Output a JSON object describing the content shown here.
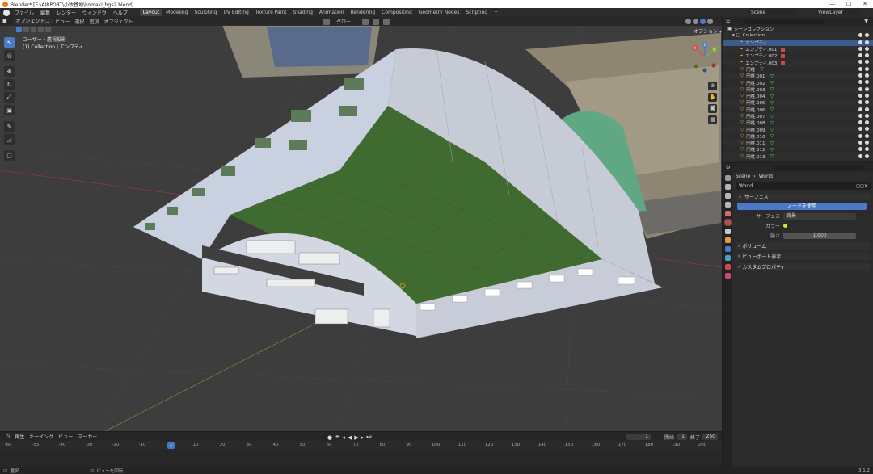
{
  "window": {
    "title": "Blender* [E:\\AIRPORT\\小牧基地\\komaki_hgs2.blend]",
    "buttons": [
      "—",
      "☐",
      "✕"
    ]
  },
  "topbar": {
    "menu": [
      "ファイル",
      "編集",
      "レンダー",
      "ウィンドウ",
      "ヘルプ"
    ],
    "tabs": [
      "Layout",
      "Modeling",
      "Sculpting",
      "UV Editing",
      "Texture Paint",
      "Shading",
      "Animation",
      "Rendering",
      "Compositing",
      "Geometry Nodes",
      "Scripting"
    ],
    "active_tab": "Layout",
    "add_tab": "+",
    "scene": "Scene",
    "view_layer": "ViewLayer"
  },
  "viewport": {
    "header": {
      "mode": "オブジェクト...",
      "menu": [
        "ビュー",
        "選択",
        "追加",
        "オブジェクト"
      ],
      "transform": "グロー..."
    },
    "options": "オプション ▾",
    "info_line1": "ユーザー・透視投影",
    "info_line2": "(1) Collection | エンプティ",
    "gizmo": {
      "x": "X",
      "y": "Y",
      "z": "Z"
    }
  },
  "timeline": {
    "menu": [
      "再生",
      "キーイング",
      "ビュー",
      "マーカー"
    ],
    "current_frame": "1",
    "start_label": "開始",
    "start": "1",
    "end_label": "終了",
    "end": "250",
    "ticks": [
      "-60",
      "-55",
      "-40",
      "-30",
      "-20",
      "-10",
      "10",
      "20",
      "30",
      "40",
      "50",
      "60",
      "70",
      "80",
      "90",
      "100",
      "110",
      "120",
      "130",
      "140",
      "150",
      "160",
      "170",
      "180",
      "190",
      "200"
    ],
    "playhead": "1"
  },
  "statusbar": {
    "left": "選択",
    "middle": "ビューを回転",
    "version": "3.1.2"
  },
  "outliner": {
    "root": "シーンコレクション",
    "collection": "Collection",
    "items": [
      {
        "name": "エンプティ",
        "selected": true,
        "type": "empty"
      },
      {
        "name": "エンプティ.001",
        "selected": false,
        "type": "empty"
      },
      {
        "name": "エンプティ.002",
        "selected": false,
        "type": "empty"
      },
      {
        "name": "エンプティ.003",
        "selected": false,
        "type": "empty"
      },
      {
        "name": "円柱",
        "selected": false,
        "type": "mesh"
      },
      {
        "name": "円柱.001",
        "selected": false,
        "type": "mesh"
      },
      {
        "name": "円柱.002",
        "selected": false,
        "type": "mesh"
      },
      {
        "name": "円柱.003",
        "selected": false,
        "type": "mesh"
      },
      {
        "name": "円柱.004",
        "selected": false,
        "type": "mesh"
      },
      {
        "name": "円柱.005",
        "selected": false,
        "type": "mesh"
      },
      {
        "name": "円柱.006",
        "selected": false,
        "type": "mesh"
      },
      {
        "name": "円柱.007",
        "selected": false,
        "type": "mesh"
      },
      {
        "name": "円柱.008",
        "selected": false,
        "type": "mesh"
      },
      {
        "name": "円柱.009",
        "selected": false,
        "type": "mesh"
      },
      {
        "name": "円柱.010",
        "selected": false,
        "type": "mesh"
      },
      {
        "name": "円柱.011",
        "selected": false,
        "type": "mesh"
      },
      {
        "name": "円柱.012",
        "selected": false,
        "type": "mesh"
      },
      {
        "name": "円柱.013",
        "selected": false,
        "type": "mesh"
      }
    ]
  },
  "properties": {
    "breadcrumb_scene": "Scene",
    "breadcrumb_sep": "›",
    "breadcrumb_world": "World",
    "world_name": "World",
    "surface_panel": "サーフェス",
    "use_nodes": "ノードを使用",
    "surface_label": "サーフェス",
    "surface_value": "背景",
    "color_label": "カラー",
    "strength_label": "強さ",
    "strength_value": "1.000",
    "volume_panel": "ボリューム",
    "viewport_display_panel": "ビューポート表示",
    "custom_props_panel": "カスタムプロパティ"
  },
  "colors": {
    "accent": "#4a79c8",
    "selected_row": "#3b5b8c",
    "modifier_icon": "#5fd46a",
    "roof_green": "#3f6b30"
  }
}
